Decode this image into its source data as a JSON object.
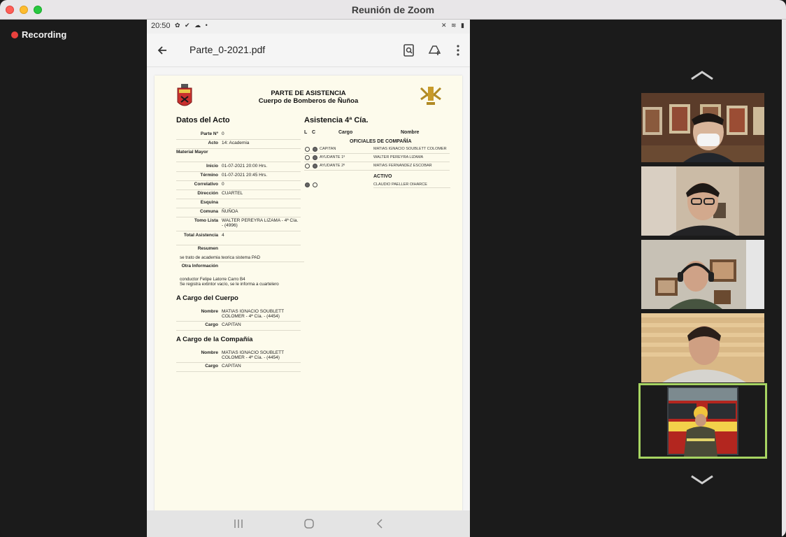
{
  "window": {
    "title": "Reunión de Zoom"
  },
  "recording": {
    "label": "Recording"
  },
  "phone": {
    "status_time": "20:50",
    "filename": "Parte_0-2021.pdf"
  },
  "pdf": {
    "header_line1": "PARTE DE ASISTENCIA",
    "header_line2": "Cuerpo de Bomberos de Ñuñoa",
    "datos_title": "Datos del Acto",
    "datos": [
      {
        "k": "Parte Nº",
        "v": "0"
      },
      {
        "k": "Acto",
        "v": "14: Academia"
      },
      {
        "k": "Material Mayor",
        "v": ""
      },
      {
        "k": "Inicio",
        "v": "01-07-2021 20:00 Hrs."
      },
      {
        "k": "Término",
        "v": "01-07-2021 20:45 Hrs."
      },
      {
        "k": "Correlativo",
        "v": "0"
      },
      {
        "k": "Dirección",
        "v": "CUARTEL"
      },
      {
        "k": "Esquina",
        "v": ""
      },
      {
        "k": "Comuna",
        "v": "ÑUÑOA"
      },
      {
        "k": "Tomo Lista",
        "v": "WALTER PEREYRA LIZAMA - 4ª Cía. - (4996)"
      },
      {
        "k": "Total Asistencia",
        "v": "4"
      }
    ],
    "resumen_label": "Resumen",
    "resumen_text": "se trato de academia teorica sistema PAD",
    "otra_label": "Otra Información",
    "otra_text_1": "conductor Felipe Latorre Carro B4",
    "otra_text_2": "Se registra extintor vacío, se le informa a cuartelero",
    "cuerpo_title": "A Cargo del Cuerpo",
    "cuerpo_nombre_k": "Nombre",
    "cuerpo_nombre_v": "MATIAS IGNACIO SOUBLETT COLOMER - 4ª Cía. - (4454)",
    "cuerpo_cargo_k": "Cargo",
    "cuerpo_cargo_v": "CAPITAN",
    "compania_title": "A Cargo de la Compañía",
    "compania_nombre_k": "Nombre",
    "compania_nombre_v": "MATIAS IGNACIO SOUBLETT COLOMER - 4ª Cía. - (4454)",
    "compania_cargo_k": "Cargo",
    "compania_cargo_v": "CAPITAN",
    "asistencia_title": "Asistencia 4ª Cía.",
    "col_l": "L",
    "col_c": "C",
    "col_cargo": "Cargo",
    "col_nombre": "Nombre",
    "oficiales_title": "OFICIALES DE COMPAÑÍA",
    "oficiales": [
      {
        "cargo": "CAPITAN",
        "nombre": "MATIAS IGNACIO SOUBLETT COLOMER"
      },
      {
        "cargo": "AYUDANTE 1º",
        "nombre": "WALTER PEREYRA LIZAMA"
      },
      {
        "cargo": "AYUDANTE 2º",
        "nombre": "MATIAS FERNANDEZ ESCOBAR"
      }
    ],
    "activo_title": "ACTIVO",
    "activo": [
      {
        "cargo": "",
        "nombre": "CLAUDIO PAELLER OIHARCE"
      }
    ]
  },
  "participants": [
    {
      "name": "participant-1"
    },
    {
      "name": "participant-2"
    },
    {
      "name": "participant-3"
    },
    {
      "name": "participant-4"
    },
    {
      "name": "participant-5"
    }
  ],
  "colors": {
    "active_speaker_border": "#a7d462",
    "recording_dot": "#e9413d",
    "pdf_page": "#fdfbec"
  }
}
